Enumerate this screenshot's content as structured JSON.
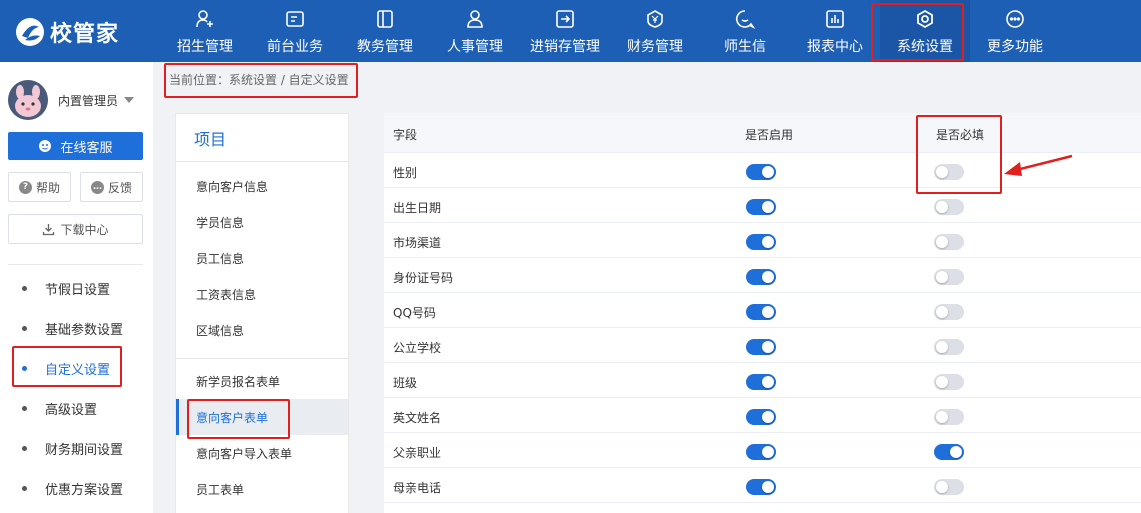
{
  "brand": {
    "name": "校管家"
  },
  "nav": [
    {
      "label": "招生管理",
      "icon": "user-add-icon"
    },
    {
      "label": "前台业务",
      "icon": "monitor-icon"
    },
    {
      "label": "教务管理",
      "icon": "book-icon"
    },
    {
      "label": "人事管理",
      "icon": "person-icon"
    },
    {
      "label": "进销存管理",
      "icon": "inout-icon"
    },
    {
      "label": "财务管理",
      "icon": "yuan-shield-icon"
    },
    {
      "label": "师生信",
      "icon": "chat-icon"
    },
    {
      "label": "报表中心",
      "icon": "chart-icon"
    },
    {
      "label": "系统设置",
      "icon": "settings-hex-icon",
      "active": true
    },
    {
      "label": "更多功能",
      "icon": "more-circle-icon"
    }
  ],
  "sidebar": {
    "user_name": "内置管理员",
    "service_label": "在线客服",
    "help_label": "帮助",
    "feedback_label": "反馈",
    "download_label": "下载中心",
    "menu": [
      {
        "label": "节假日设置"
      },
      {
        "label": "基础参数设置"
      },
      {
        "label": "自定义设置",
        "active": true
      },
      {
        "label": "高级设置"
      },
      {
        "label": "财务期间设置"
      },
      {
        "label": "优惠方案设置"
      }
    ]
  },
  "breadcrumb": "当前位置：系统设置 / 自定义设置",
  "project_panel": {
    "title": "项目",
    "group1": [
      "意向客户信息",
      "学员信息",
      "员工信息",
      "工资表信息",
      "区域信息"
    ],
    "group2": [
      "新学员报名表单",
      "意向客户表单",
      "意向客户导入表单",
      "员工表单"
    ],
    "active": "意向客户表单"
  },
  "table": {
    "headers": {
      "field": "字段",
      "enabled": "是否启用",
      "required": "是否必填"
    },
    "rows": [
      {
        "field": "性别",
        "enabled": true,
        "required": false
      },
      {
        "field": "出生日期",
        "enabled": true,
        "required": false
      },
      {
        "field": "市场渠道",
        "enabled": true,
        "required": false
      },
      {
        "field": "身份证号码",
        "enabled": true,
        "required": false
      },
      {
        "field": "QQ号码",
        "enabled": true,
        "required": false
      },
      {
        "field": "公立学校",
        "enabled": true,
        "required": false
      },
      {
        "field": "班级",
        "enabled": true,
        "required": false
      },
      {
        "field": "英文姓名",
        "enabled": true,
        "required": false
      },
      {
        "field": "父亲职业",
        "enabled": true,
        "required": true
      },
      {
        "field": "母亲电话",
        "enabled": true,
        "required": false
      }
    ]
  },
  "colors": {
    "primary": "#1e6fd9",
    "topbar": "#1e5fb6",
    "highlight": "#e02020"
  }
}
